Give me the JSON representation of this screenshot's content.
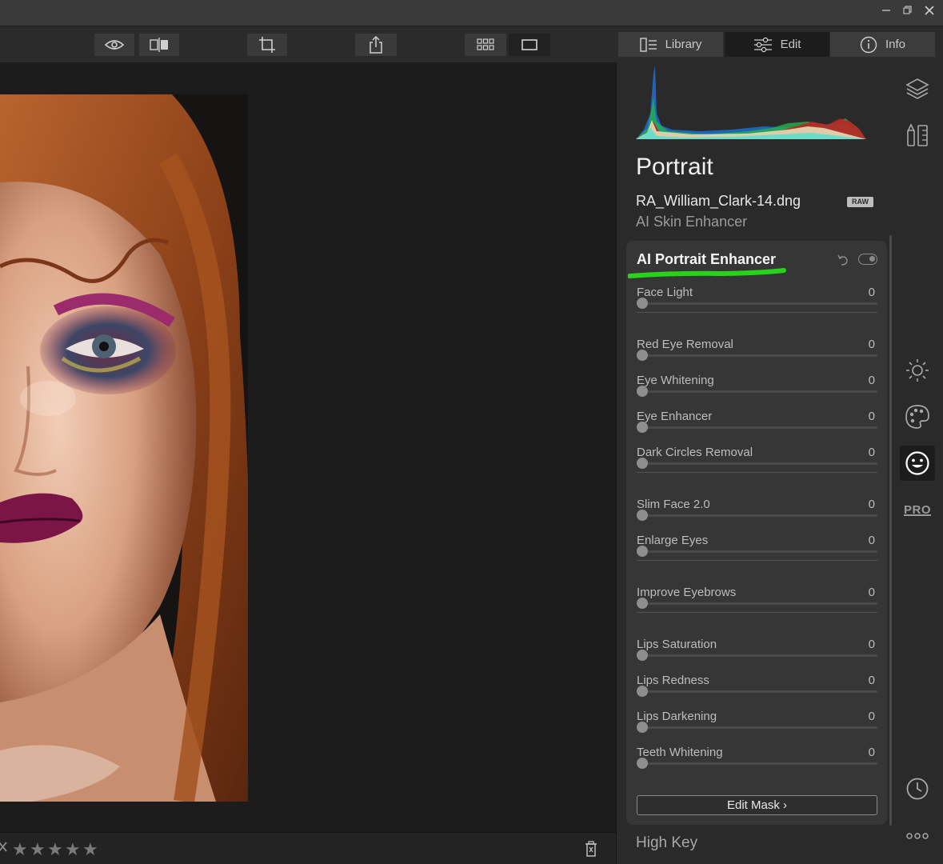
{
  "window": {
    "minimize_icon": "minimize-icon",
    "restore_icon": "restore-icon",
    "close_icon": "close-icon"
  },
  "toolbar": {
    "left_tools": [
      "eye-icon",
      "compare-icon",
      "crop-icon",
      "share-icon",
      "grid-view-icon",
      "single-view-icon"
    ],
    "modes": [
      {
        "label": "Library",
        "icon": "library-icon"
      },
      {
        "label": "Edit",
        "icon": "sliders-icon",
        "active": true
      },
      {
        "label": "Info",
        "icon": "info-icon"
      }
    ]
  },
  "footer": {
    "reject_icon": "reject-x-icon",
    "rating_stars": 5,
    "rating_value": 0,
    "delete_icon": "trash-icon"
  },
  "panel": {
    "title": "Portrait",
    "filename": "RA_William_Clark-14.dng",
    "raw_badge": "RAW",
    "previous_section": "AI Skin Enhancer",
    "section": {
      "title": "AI Portrait Enhancer",
      "highlight_color": "#27d419",
      "groups": [
        [
          {
            "label": "Face Light",
            "value": "0",
            "level": 0
          }
        ],
        [
          {
            "label": "Red Eye Removal",
            "value": "0",
            "level": 0
          },
          {
            "label": "Eye Whitening",
            "value": "0",
            "level": 0
          },
          {
            "label": "Eye Enhancer",
            "value": "0",
            "level": 0
          },
          {
            "label": "Dark Circles Removal",
            "value": "0",
            "level": 0
          }
        ],
        [
          {
            "label": "Slim Face 2.0",
            "value": "0",
            "level": 0
          },
          {
            "label": "Enlarge Eyes",
            "value": "0",
            "level": 0
          }
        ],
        [
          {
            "label": "Improve Eyebrows",
            "value": "0",
            "level": 0
          }
        ],
        [
          {
            "label": "Lips Saturation",
            "value": "0",
            "level": 0
          },
          {
            "label": "Lips Redness",
            "value": "0",
            "level": 0
          },
          {
            "label": "Lips Darkening",
            "value": "0",
            "level": 0
          },
          {
            "label": "Teeth Whitening",
            "value": "0",
            "level": 0
          }
        ]
      ],
      "edit_mask_label": "Edit Mask ›"
    },
    "next_section": "High Key"
  },
  "rail": {
    "icons": [
      "layers-icon",
      "presets-icon",
      "essentials-sun-icon",
      "creative-palette-icon",
      "portrait-face-icon",
      "pro-icon",
      "history-clock-icon",
      "more-icon"
    ],
    "pro_label": "PRO",
    "active": "portrait-face-icon"
  },
  "colors": {
    "background": "#1c1c1c",
    "panel": "#2a2a2a",
    "section": "#363636",
    "highlight": "#27d419"
  }
}
